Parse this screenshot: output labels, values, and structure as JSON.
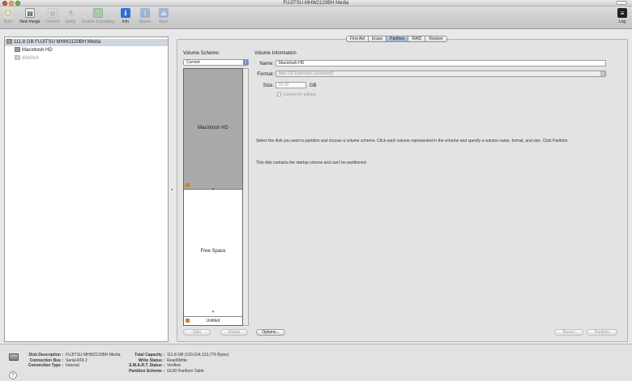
{
  "window": {
    "title": "FUJITSU MHW2120BH Media"
  },
  "toolbar": {
    "burn": "Burn",
    "new_image": "New Image",
    "convert": "Convert",
    "verify": "Verify",
    "enable_journaling": "Enable Journaling",
    "info": "Info",
    "mount": "Mount",
    "eject": "Eject",
    "log": "Log"
  },
  "sidebar": {
    "items": [
      {
        "label": "111.8 GB FUJITSU MHW2120BH Media"
      },
      {
        "label": "Macintosh HD"
      },
      {
        "label": "disk0s4"
      }
    ]
  },
  "tabs": [
    {
      "label": "First Aid"
    },
    {
      "label": "Erase"
    },
    {
      "label": "Partition"
    },
    {
      "label": "RAID"
    },
    {
      "label": "Restore"
    }
  ],
  "partition": {
    "volume_scheme_label": "Volume Scheme:",
    "volume_scheme_value": "Current",
    "volume_info_label": "Volume Information",
    "name_label": "Name:",
    "name_value": "Macintosh HD",
    "format_label": "Format:",
    "format_value": "Mac OS Extended (Journaled)",
    "size_label": "Size:",
    "size_value": "55.00",
    "size_unit": "GB",
    "locked_label": "Locked for editing",
    "partitions": [
      {
        "label": "Macintosh HD"
      },
      {
        "label": "Free Space"
      }
    ],
    "strip_label": "Untitled",
    "instruction": "Select the disk you want to partition and choose a volume scheme. Click each volume represented in the scheme and specify a volume name, format, and size. Click Partition.",
    "note": "This disk contains the startup volume and can't be partitioned.",
    "buttons": {
      "split": "Split",
      "delete": "Delete",
      "options": "Options...",
      "revert": "Revert",
      "partition": "Partition"
    }
  },
  "info": {
    "left": [
      {
        "key": "Disk Description :",
        "value": "FUJITSU MHW2120BH Media"
      },
      {
        "key": "Connection Bus :",
        "value": "Serial ATA 2"
      },
      {
        "key": "Connection Type :",
        "value": "Internal"
      }
    ],
    "right": [
      {
        "key": "Total Capacity :",
        "value": "111.8 GB (120,034,123,776 Bytes)"
      },
      {
        "key": "Write Status :",
        "value": "Read/Write"
      },
      {
        "key": "S.M.A.R.T. Status :",
        "value": "Verified"
      },
      {
        "key": "Partition Scheme :",
        "value": "GUID Partition Table"
      }
    ]
  },
  "colors": {
    "used_partition": "#a9a9a9",
    "selection": "#d0d6e0",
    "accent_blue": "#2f6fd6"
  }
}
